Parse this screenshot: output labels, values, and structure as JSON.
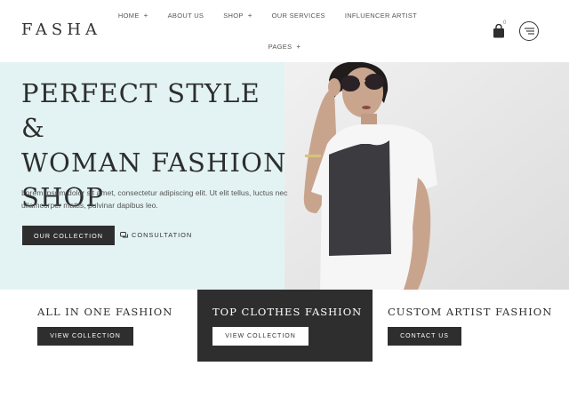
{
  "header": {
    "logo": "FASHA",
    "nav_row1": [
      {
        "label": "HOME",
        "has_submenu": true
      },
      {
        "label": "ABOUT US",
        "has_submenu": false
      },
      {
        "label": "SHOP",
        "has_submenu": true
      },
      {
        "label": "OUR SERVICES",
        "has_submenu": false
      },
      {
        "label": "INFLUENCER ARTIST",
        "has_submenu": false
      }
    ],
    "nav_row2": [
      {
        "label": "PAGES",
        "has_submenu": true
      }
    ],
    "submenu_symbol": "+",
    "cart_count": "0",
    "cart_icon": "shopping-bag-icon",
    "menu_icon": "hamburger-menu-icon"
  },
  "hero": {
    "title_line1": "PERFECT STYLE &",
    "title_line2": "WOMAN FASHION",
    "title_line3": "SHOP",
    "text": "Lorem ipsum dolor sit amet, consectetur adipiscing elit. Ut elit tellus, luctus nec ullamcorper mattis, pulvinar dapibus leo.",
    "primary_button": "OUR COLLECTION",
    "secondary_link": "CONSULTATION",
    "secondary_icon": "chat-icon"
  },
  "cards": [
    {
      "title": "ALL IN ONE FASHION",
      "button": "VIEW COLLECTION"
    },
    {
      "title": "TOP CLOTHES FASHION",
      "button": "VIEW COLLECTION"
    },
    {
      "title": "CUSTOM ARTIST FASHION",
      "button": "CONTACT US"
    }
  ],
  "colors": {
    "hero_bg": "#e3f3f4",
    "dark": "#2e2e2e",
    "accent": "#2aa5b5"
  }
}
